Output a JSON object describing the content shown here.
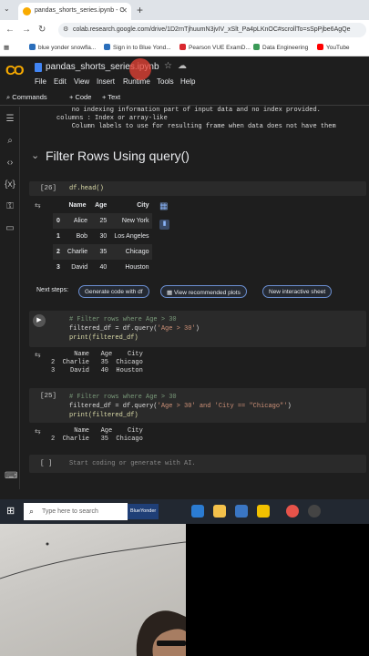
{
  "browser": {
    "tab_title": "pandas_shorts_series.ipynb - C",
    "url": "colab.research.google.com/drive/1D2rnTjhuumN3jvIV_xSlt_Pa4pLKnOC#scrollTo=sSpPjbe6AgQe",
    "bookmarks": [
      "blue yonder snowfla...",
      "Sign in to Blue Yond...",
      "Pearson VUE ExamD...",
      "Data Engineering",
      "YouTube"
    ]
  },
  "colab": {
    "logo": "CO",
    "notebook_title": "pandas_shorts_series.ipynb",
    "menu": [
      "File",
      "Edit",
      "View",
      "Insert",
      "Runtime",
      "Tools",
      "Help"
    ],
    "toolbar": [
      "Commands",
      "+ Code",
      "+ Text"
    ]
  },
  "notebook": {
    "prev_output": [
      "    no indexing information part of input data and no index provided.",
      "columns : Index or array-like",
      "    Column labels to use for resulting frame when data does not have them"
    ],
    "section_heading": "Filter Rows Using query()",
    "cell1": {
      "exec": "[26]",
      "code": "df.head()",
      "table": {
        "columns": [
          "Name",
          "Age",
          "City"
        ],
        "rows": [
          [
            "0",
            "Alice",
            "25",
            "New York"
          ],
          [
            "1",
            "Bob",
            "30",
            "Los Angeles"
          ],
          [
            "2",
            "Charlie",
            "35",
            "Chicago"
          ],
          [
            "3",
            "David",
            "40",
            "Houston"
          ]
        ]
      }
    },
    "next_steps": {
      "label": "Next steps:",
      "chips": [
        "Generate code with df",
        "View recommended plots",
        "New interactive sheet"
      ]
    },
    "cell2": {
      "comment": "# Filter rows where Age > 30",
      "line2_a": "filtered_df = df.query(",
      "line2_str": "'Age > 30'",
      "line2_b": ")",
      "line3": "print(filtered_df)",
      "output": [
        "      Name   Age    City",
        "2  Charlie   35  Chicago",
        "3    David   40  Houston"
      ]
    },
    "cell3": {
      "exec": "[25]",
      "comment": "# Filter rows where Age > 30",
      "line2_a": "filtered_df = df.query(",
      "line2_str": "'Age > 30' and 'City == \"Chicago\"'",
      "line2_b": ")",
      "line3": "print(filtered_df)",
      "output": [
        "      Name   Age    City",
        "2  Charlie   35  Chicago"
      ]
    },
    "cell4": {
      "exec": "[ ]",
      "placeholder": "Start coding or generate with AI."
    }
  },
  "taskbar": {
    "search_placeholder": "Type here to search",
    "badge": "BlueYonder"
  }
}
